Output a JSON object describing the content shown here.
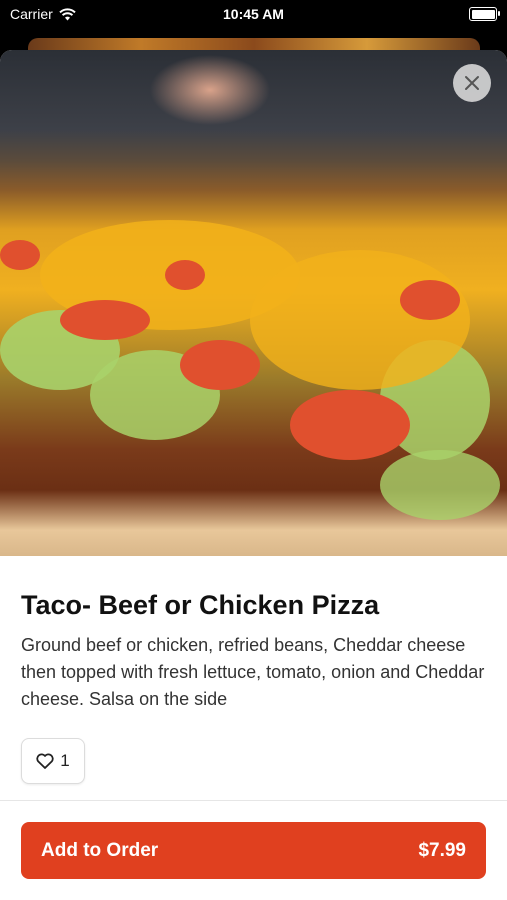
{
  "status_bar": {
    "carrier": "Carrier",
    "time": "10:45 AM"
  },
  "item": {
    "title": "Taco- Beef or Chicken Pizza",
    "description": "Ground beef or chicken, refried beans, Cheddar cheese then topped with fresh lettuce, tomato, onion and Cheddar cheese. Salsa on the side",
    "likes": "1",
    "photo_alt": "Taco pizza photo"
  },
  "order": {
    "label": "Add to Order",
    "price": "$7.99"
  },
  "colors": {
    "accent": "#e0401f"
  },
  "icons": {
    "close": "close-icon",
    "like": "heart-icon",
    "wifi": "wifi-icon",
    "battery": "battery-icon"
  }
}
